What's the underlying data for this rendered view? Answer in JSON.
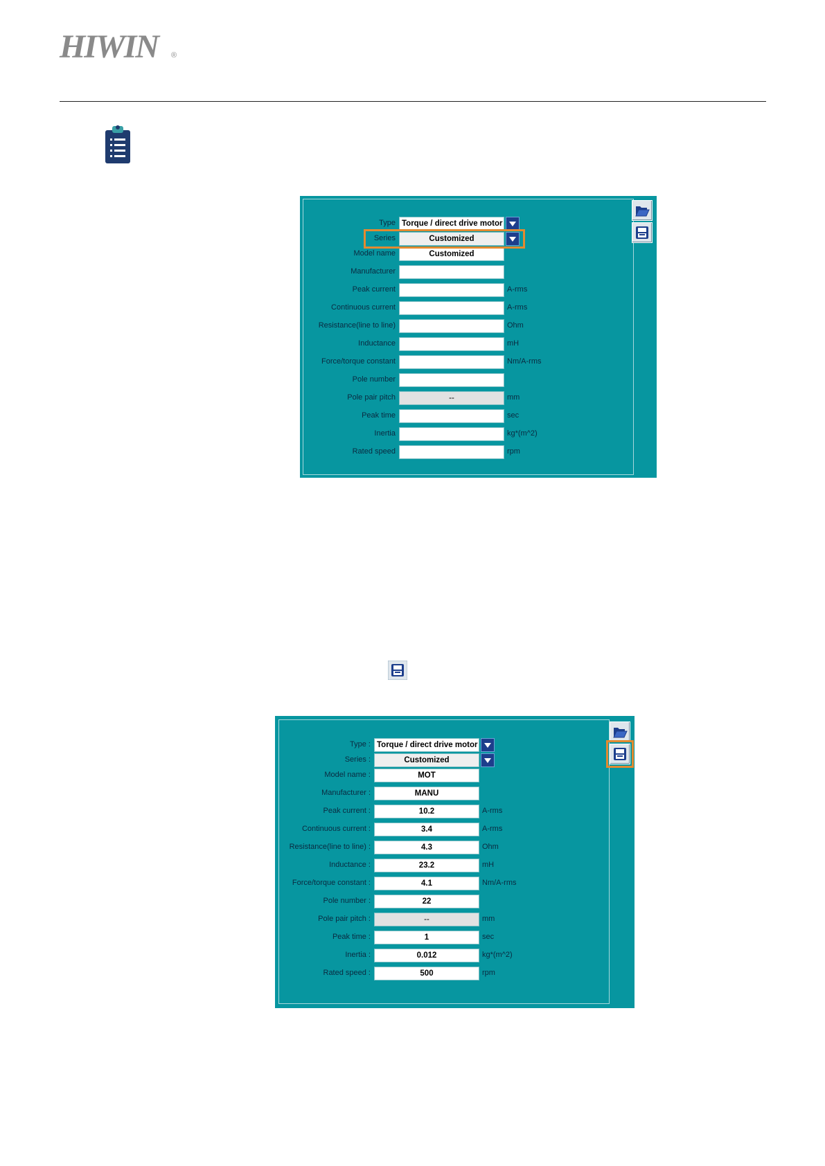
{
  "header": {
    "logo_text": "HIWIN",
    "registered_mark": "®"
  },
  "icons": {
    "note": "clipboard-list-icon",
    "inline_save": "floppy-save-icon",
    "panel_open": "folder-open-icon",
    "panel_save": "floppy-save-icon",
    "dropdown": "triangle-down-icon"
  },
  "colors": {
    "panel_bg": "#0796a0",
    "highlight": "#e38a30",
    "dropdown_bg": "#1d3e8c",
    "logo": "#8a8a8a"
  },
  "panel1": {
    "type": {
      "label": "Type",
      "value": "Torque / direct drive motor"
    },
    "series": {
      "label": "Series",
      "value": "Customized"
    },
    "model_name": {
      "label": "Model name",
      "value": "Customized"
    },
    "manufacturer": {
      "label": "Manufacturer",
      "value": ""
    },
    "peak_current": {
      "label": "Peak current",
      "value": "",
      "unit": "A-rms"
    },
    "continuous_current": {
      "label": "Continuous current",
      "value": "",
      "unit": "A-rms"
    },
    "resistance": {
      "label": "Resistance(line to line)",
      "value": "",
      "unit": "Ohm"
    },
    "inductance": {
      "label": "Inductance",
      "value": "",
      "unit": "mH"
    },
    "force_constant": {
      "label": "Force/torque constant",
      "value": "",
      "unit": "Nm/A-rms"
    },
    "pole_number": {
      "label": "Pole number",
      "value": ""
    },
    "pole_pair_pitch": {
      "label": "Pole pair pitch",
      "value": "--",
      "unit": "mm"
    },
    "peak_time": {
      "label": "Peak time",
      "value": "",
      "unit": "sec"
    },
    "inertia": {
      "label": "Inertia",
      "value": "",
      "unit": "kg*(m^2)"
    },
    "rated_speed": {
      "label": "Rated speed",
      "value": "",
      "unit": "rpm"
    }
  },
  "panel2": {
    "type": {
      "label": "Type :",
      "value": "Torque / direct drive motor"
    },
    "series": {
      "label": "Series :",
      "value": "Customized"
    },
    "model_name": {
      "label": "Model name :",
      "value": "MOT"
    },
    "manufacturer": {
      "label": "Manufacturer :",
      "value": "MANU"
    },
    "peak_current": {
      "label": "Peak current :",
      "value": "10.2",
      "unit": "A-rms"
    },
    "continuous_current": {
      "label": "Continuous current :",
      "value": "3.4",
      "unit": "A-rms"
    },
    "resistance": {
      "label": "Resistance(line to line) :",
      "value": "4.3",
      "unit": "Ohm"
    },
    "inductance": {
      "label": "Inductance :",
      "value": "23.2",
      "unit": "mH"
    },
    "force_constant": {
      "label": "Force/torque constant :",
      "value": "4.1",
      "unit": "Nm/A-rms"
    },
    "pole_number": {
      "label": "Pole number :",
      "value": "22"
    },
    "pole_pair_pitch": {
      "label": "Pole pair pitch :",
      "value": "--",
      "unit": "mm"
    },
    "peak_time": {
      "label": "Peak time :",
      "value": "1",
      "unit": "sec"
    },
    "inertia": {
      "label": "Inertia :",
      "value": "0.012",
      "unit": "kg*(m^2)"
    },
    "rated_speed": {
      "label": "Rated speed :",
      "value": "500",
      "unit": "rpm"
    }
  }
}
